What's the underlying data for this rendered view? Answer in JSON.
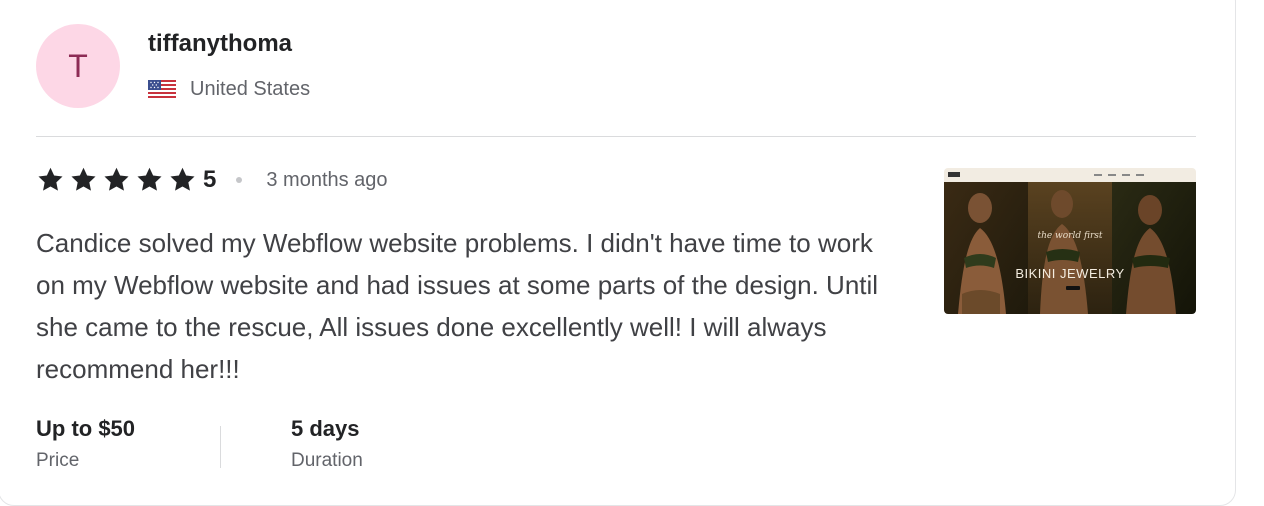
{
  "reviewer": {
    "avatar_initial": "T",
    "username": "tiffanythoma",
    "country": "United States",
    "flag_icon": "us-flag-icon"
  },
  "review": {
    "rating": 5,
    "rating_label": "5",
    "time_ago": "3 months ago",
    "text": "Candice solved my Webflow website problems. I didn't have time to work on my Webflow website and had issues at some parts of the design. Until she came to the rescue, All issues done excellently well! I will always recommend her!!!"
  },
  "details": {
    "price_value": "Up to $50",
    "price_label": "Price",
    "duration_value": "5 days",
    "duration_label": "Duration"
  },
  "thumbnail": {
    "script_text": "the world first",
    "headline": "BIKINI JEWELRY"
  },
  "colors": {
    "avatar_bg": "#fdd7e6",
    "avatar_text": "#8d2b55",
    "star": "#222325"
  }
}
